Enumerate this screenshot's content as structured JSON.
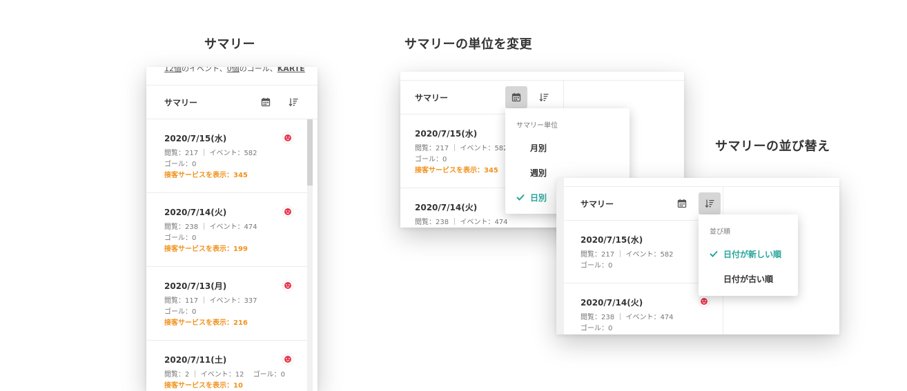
{
  "sections": {
    "summary": "サマリー",
    "unit_change": "サマリーの単位を変更",
    "sort": "サマリーの並び替え"
  },
  "panel1": {
    "top_text": {
      "events_count": "12個",
      "events_suffix": "のイベント、",
      "goals_count": "0個",
      "goals_suffix": "のゴール、",
      "trailing": "KARTE"
    },
    "header": "サマリー",
    "cards": [
      {
        "date": "2020/7/15(水)",
        "stats": "閲覧：217 ｜ イベント：582",
        "goal": "ゴール：0",
        "service": "接客サービスを表示：345"
      },
      {
        "date": "2020/7/14(火)",
        "stats": "閲覧：238 ｜ イベント：474",
        "goal": "ゴール：0",
        "service": "接客サービスを表示：199"
      },
      {
        "date": "2020/7/13(月)",
        "stats": "閲覧：117 ｜ イベント：337",
        "goal": "ゴール：0",
        "service": "接客サービスを表示：216"
      },
      {
        "date": "2020/7/11(土)",
        "stats": "閲覧：2 ｜ イベント：12 　ゴール：0",
        "service": "接客サービスを表示：10"
      }
    ]
  },
  "panel2": {
    "header": "サマリー",
    "cards": [
      {
        "date": "2020/7/15(水)",
        "stats": "閲覧：217 ｜ イベント：582",
        "goal": "ゴール：0",
        "service": "接客サービスを表示：345"
      },
      {
        "date": "2020/7/14(火)",
        "stats": "閲覧：238 ｜ イベント：474"
      }
    ],
    "dropdown": {
      "heading": "サマリー単位",
      "options": [
        "月別",
        "週別",
        "日別"
      ],
      "selected": "日別"
    }
  },
  "panel3": {
    "header": "サマリー",
    "cards": [
      {
        "date": "2020/7/15(水)",
        "stats": "閲覧：217 ｜ イベント：582",
        "goal": "ゴール：0"
      },
      {
        "date": "2020/7/14(火)",
        "stats": "閲覧：238 ｜ イベント：474",
        "goal": "ゴール：0"
      }
    ],
    "dropdown": {
      "heading": "並び順",
      "options": [
        "日付が新しい順",
        "日付が古い順"
      ],
      "selected": "日付が新しい順"
    }
  },
  "icons": {
    "calendar": "calendar-icon",
    "sort": "sort-icon",
    "face": "karte-face-icon",
    "check": "check-icon"
  },
  "colors": {
    "accent": "#27a59a",
    "service": "#f0921e",
    "face": "#e8344a",
    "active_button": "#d6d6d6"
  }
}
